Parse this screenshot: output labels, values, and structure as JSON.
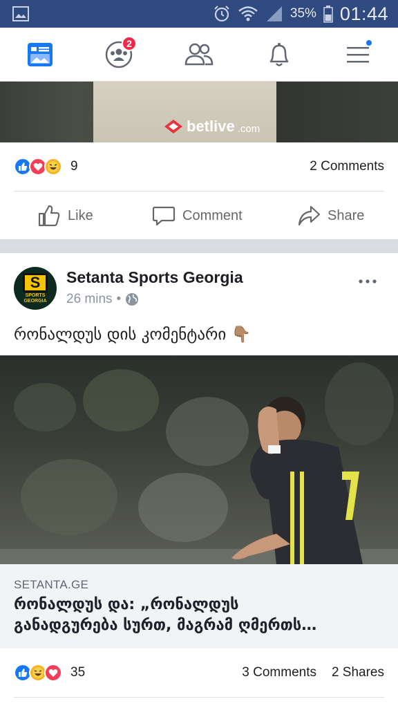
{
  "status_bar": {
    "battery_percent": "35%",
    "time": "01:44",
    "icons": [
      "gallery-icon",
      "alarm-icon",
      "wifi-icon",
      "signal-icon",
      "battery-icon"
    ]
  },
  "nav": {
    "items": [
      "news-feed-icon",
      "groups-icon",
      "friends-icon",
      "notifications-icon",
      "menu-icon"
    ],
    "groups_badge": "2",
    "active_color": "#1877f2"
  },
  "top_post": {
    "image_watermark": "betlive",
    "image_watermark_suffix": ".com",
    "reaction_count": "9",
    "comments": "2 Comments",
    "actions": {
      "like": "Like",
      "comment": "Comment",
      "share": "Share"
    }
  },
  "post": {
    "page_name": "Setanta Sports Georgia",
    "avatar_letter": "S",
    "avatar_caption": "SPORTS GEORGIA",
    "time": "26 mins",
    "separator": "•",
    "text": "რონალდუს დის კომენტარი 👇🏽",
    "link": {
      "domain": "SETANTA.GE",
      "title_line1": "რონალდუს და: „რონალდუს",
      "title_line2": "განადგურება სურთ, მაგრამ ღმერთს…"
    },
    "reaction_count": "35",
    "comments": "3 Comments",
    "shares": "2 Shares"
  },
  "colors": {
    "status_bar": "#2f4a7f",
    "like_blue": "#1877f2",
    "love_red": "#f33e58",
    "haha_yellow": "#f7b125",
    "badge_red": "#f02849"
  }
}
